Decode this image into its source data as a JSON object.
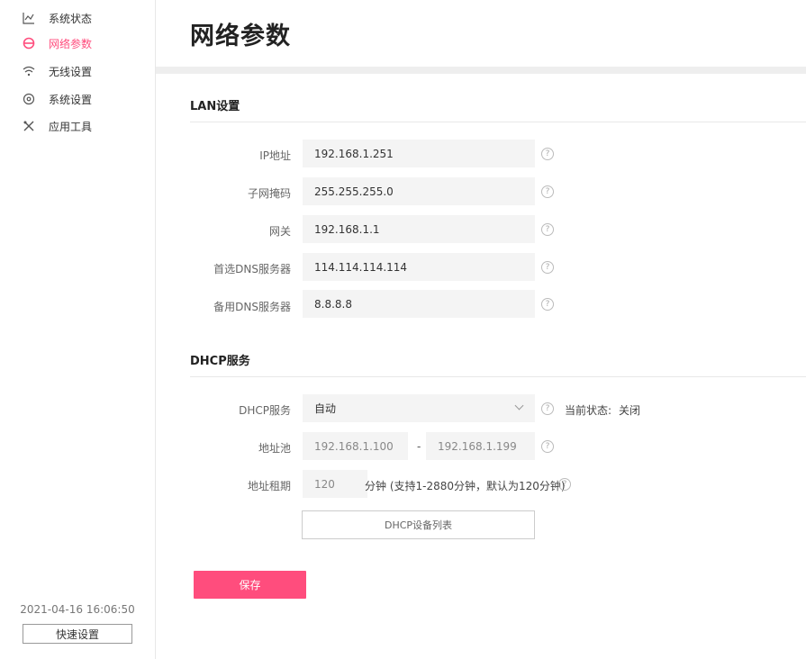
{
  "sidebar": {
    "items": [
      {
        "label": "系统状态",
        "icon": "chart-line-icon",
        "active": false
      },
      {
        "label": "网络参数",
        "icon": "network-icon",
        "active": true
      },
      {
        "label": "无线设置",
        "icon": "wifi-icon",
        "active": false
      },
      {
        "label": "系统设置",
        "icon": "gear-icon",
        "active": false
      },
      {
        "label": "应用工具",
        "icon": "tools-icon",
        "active": false
      }
    ],
    "datetime": "2021-04-16 16:06:50",
    "quick_setup_label": "快速设置"
  },
  "page": {
    "title": "网络参数"
  },
  "lan": {
    "title": "LAN设置",
    "fields": [
      {
        "label": "IP地址",
        "value": "192.168.1.251"
      },
      {
        "label": "子网掩码",
        "value": "255.255.255.0"
      },
      {
        "label": "网关",
        "value": "192.168.1.1"
      },
      {
        "label": "首选DNS服务器",
        "value": "114.114.114.114"
      },
      {
        "label": "备用DNS服务器",
        "value": "8.8.8.8"
      }
    ]
  },
  "dhcp": {
    "title": "DHCP服务",
    "service_label": "DHCP服务",
    "service_value": "自动",
    "status_label": "当前状态:",
    "status_value": "关闭",
    "pool_label": "地址池",
    "pool_start": "192.168.1.100",
    "pool_separator": "-",
    "pool_end": "192.168.1.199",
    "lease_label": "地址租期",
    "lease_value": "120",
    "lease_hint": "分钟 (支持1-2880分钟，默认为120分钟)",
    "device_list_label": "DHCP设备列表"
  },
  "actions": {
    "save_label": "保存"
  },
  "help_glyph": "?",
  "colors": {
    "accent": "#ff4d7d",
    "input_bg": "#f4f4f4"
  }
}
